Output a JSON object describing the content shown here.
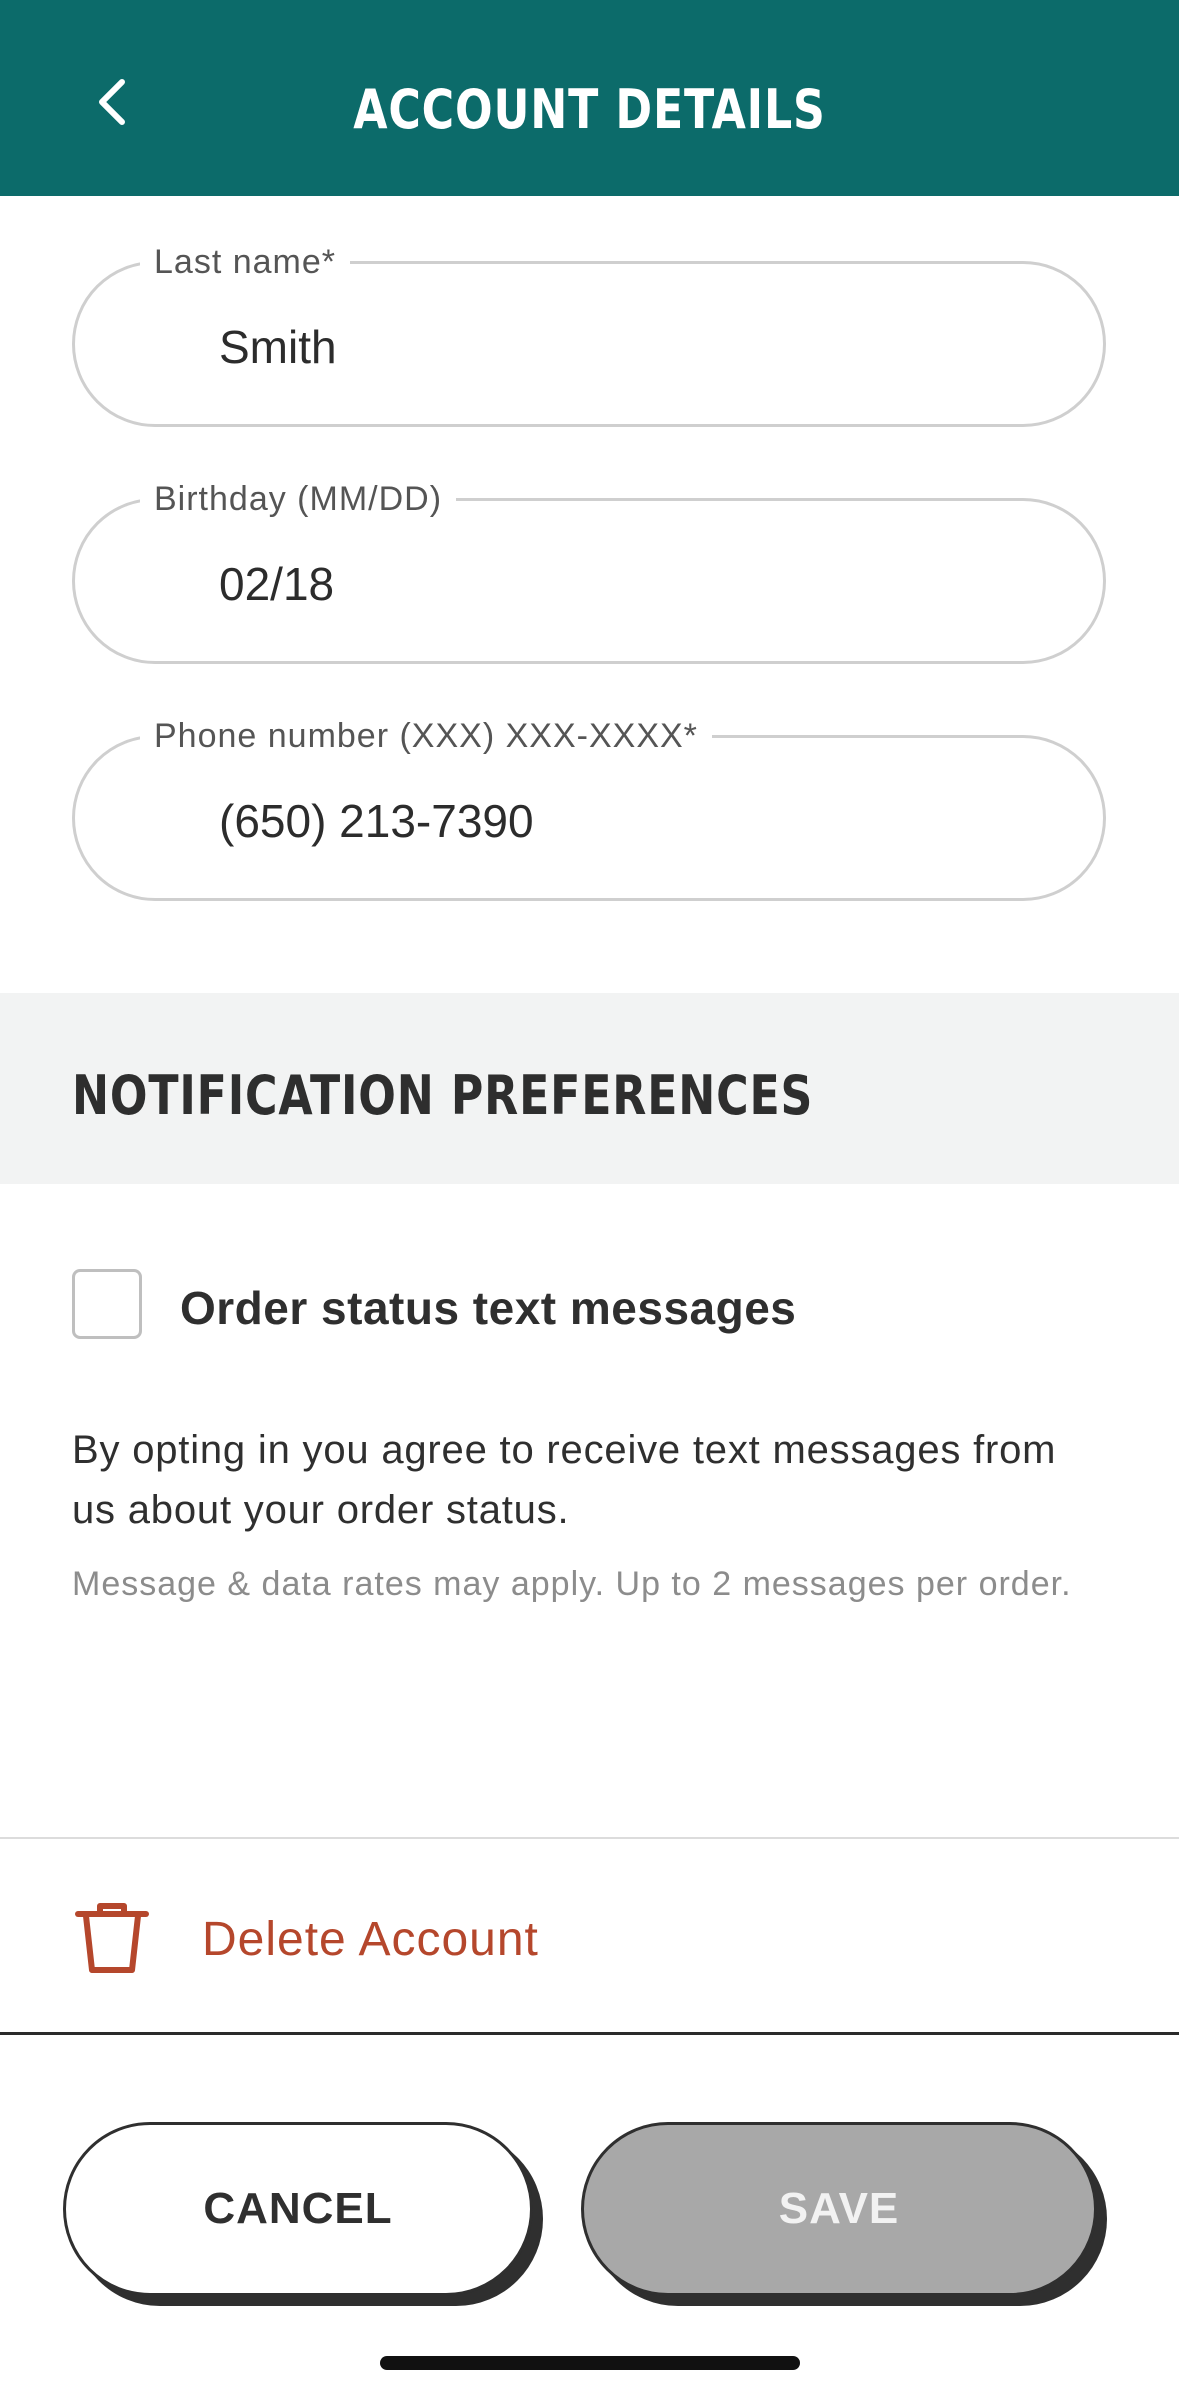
{
  "header": {
    "title": "ACCOUNT DETAILS",
    "back_icon": "chevron-left-icon"
  },
  "form": {
    "last_name": {
      "label": "Last name*",
      "value": "Smith"
    },
    "birthday": {
      "label": "Birthday (MM/DD)",
      "value": "02/18"
    },
    "phone": {
      "label": "Phone number (XXX) XXX-XXXX*",
      "value": "(650) 213-7390"
    }
  },
  "notifications": {
    "title": "NOTIFICATION PREFERENCES",
    "order_status_label": "Order status text messages",
    "order_status_checked": false,
    "description": "By opting in you agree to receive text messages from us about your order status.",
    "fine_print": "Message & data rates may apply. Up to 2 messages per order."
  },
  "delete": {
    "label": "Delete Account",
    "icon": "trash-icon",
    "color": "#b5472c"
  },
  "actions": {
    "cancel_label": "CANCEL",
    "save_label": "SAVE"
  },
  "colors": {
    "header": "#0c6b6a",
    "section_band": "#f2f3f3",
    "save_disabled": "#a8a8a8"
  }
}
